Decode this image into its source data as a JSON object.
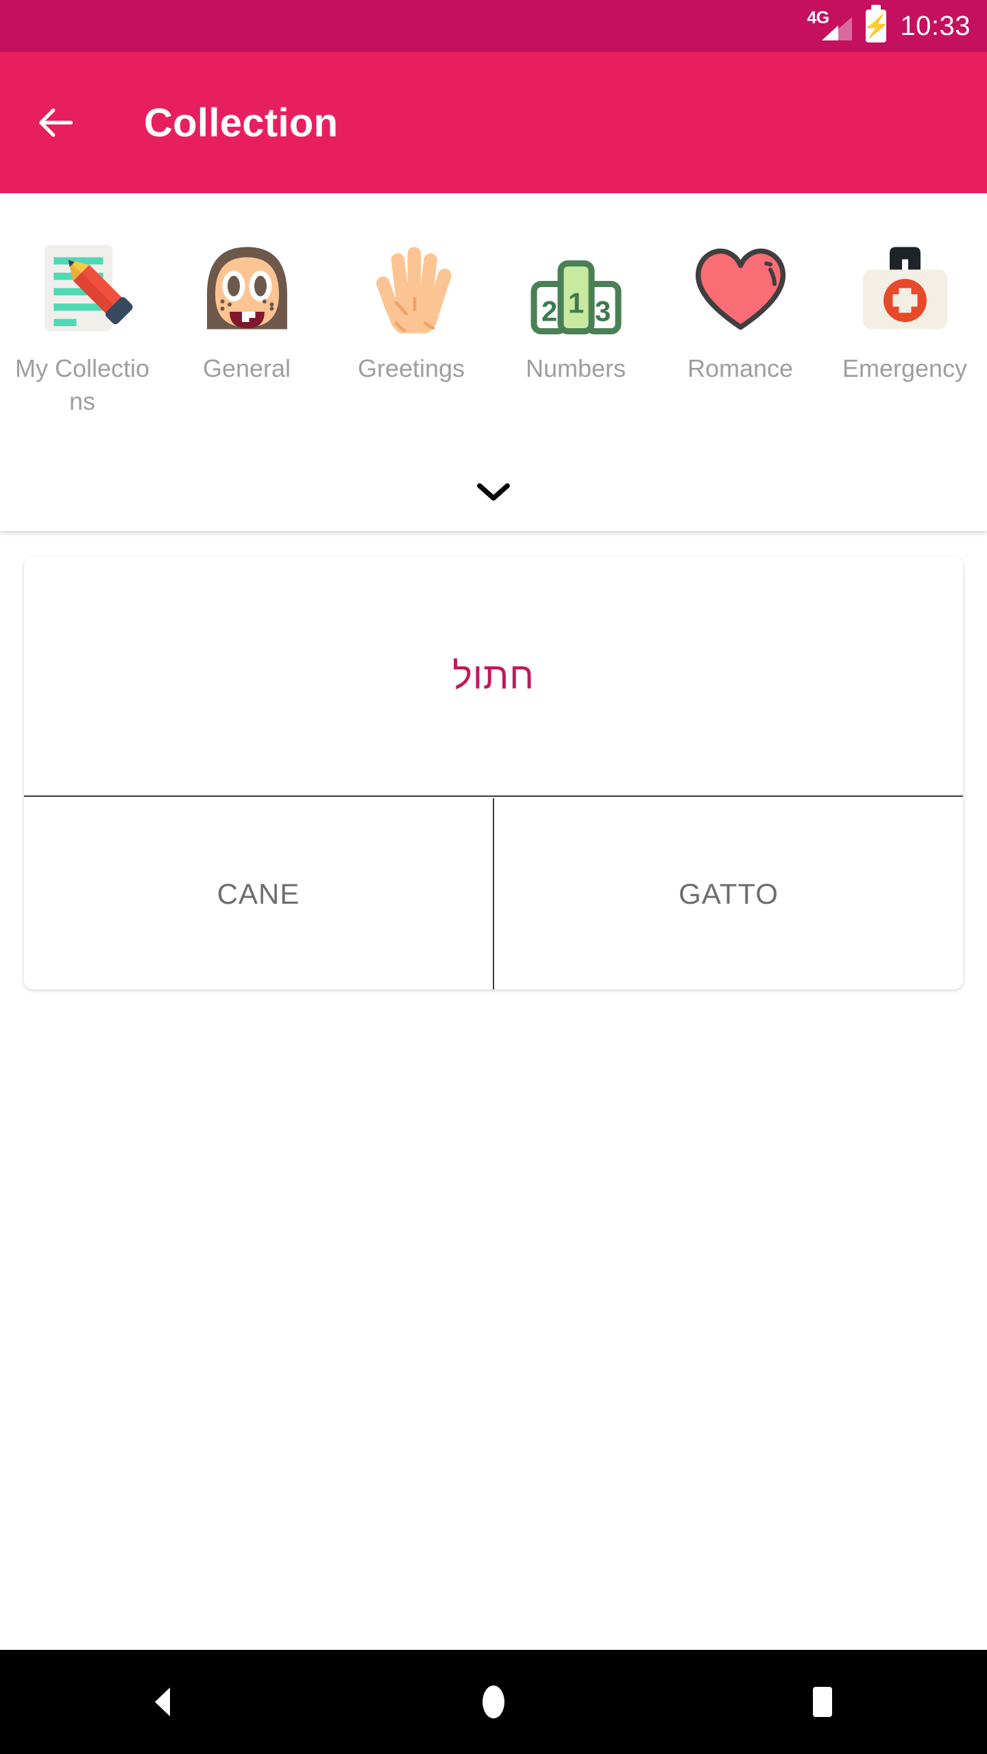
{
  "status_bar": {
    "network_label": "4G",
    "time": "10:33",
    "battery_state": "charging",
    "background_color": "#c4105f"
  },
  "app_bar": {
    "back_label": "Back",
    "title": "Collection",
    "background_color": "#e81f5e"
  },
  "categories": {
    "expand_label": "Expand categories",
    "items": [
      {
        "label": "My Collections",
        "icon": "memo-pencil-icon"
      },
      {
        "label": "General",
        "icon": "child-face-icon"
      },
      {
        "label": "Greetings",
        "icon": "raised-hand-icon"
      },
      {
        "label": "Numbers",
        "icon": "podium-icon"
      },
      {
        "label": "Romance",
        "icon": "heart-icon"
      },
      {
        "label": "Emergency",
        "icon": "first-aid-kit-icon"
      }
    ]
  },
  "quiz": {
    "question": "חתול",
    "question_color": "#c2185b",
    "answers": [
      {
        "label": "CANE"
      },
      {
        "label": "GATTO"
      }
    ]
  },
  "nav_bar": {
    "back": "back-triangle-icon",
    "home": "home-circle-icon",
    "recents": "recents-square-icon"
  }
}
